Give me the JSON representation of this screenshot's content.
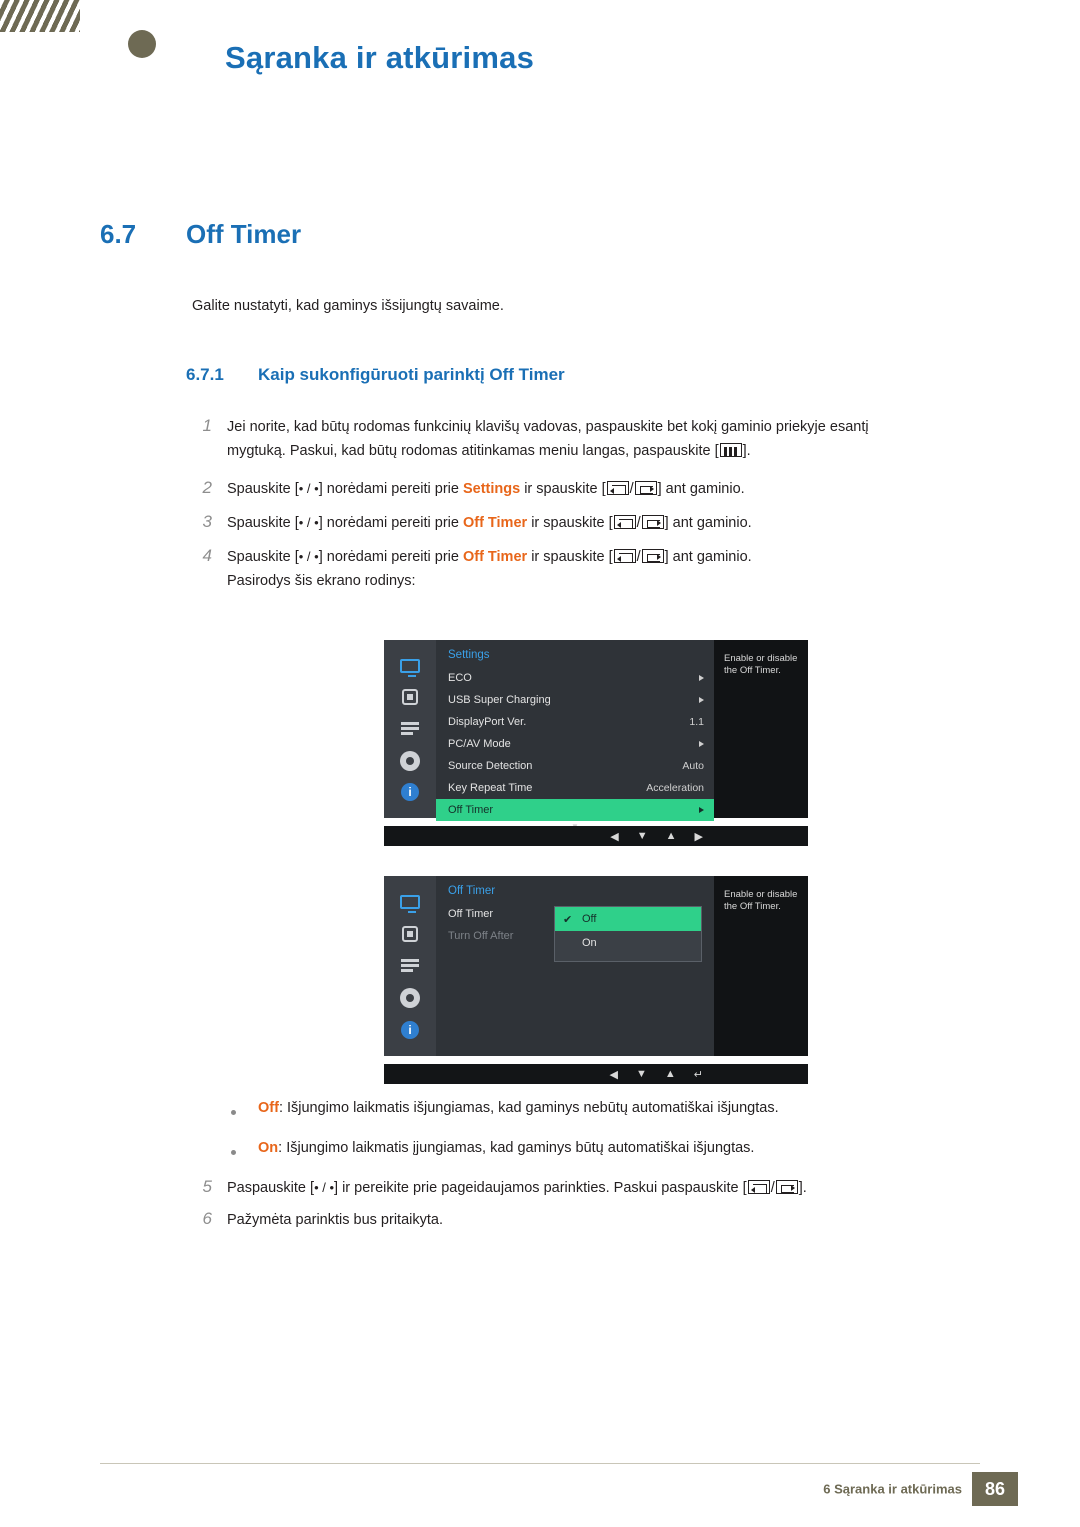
{
  "header": {
    "title": "Sąranka ir atkūrimas"
  },
  "section": {
    "number": "6.7",
    "title": "Off Timer",
    "intro": "Galite nustatyti, kad gaminys išsijungtų savaime.",
    "sub_number": "6.7.1",
    "sub_title": "Kaip sukonfigūruoti parinktį Off Timer"
  },
  "steps": [
    {
      "num": "1",
      "line1": "Jei norite, kad būtų rodomas funkcinių klavišų vadovas, paspauskite bet kokį gaminio priekyje esantį",
      "line2_a": "mygtuką. Paskui, kad būtų rodomas atitinkamas meniu langas, paspauskite [",
      "line2_b": "]."
    },
    {
      "num": "2",
      "a": "Spauskite [",
      "dots": "• / •",
      "b": "] norėdami pereiti prie ",
      "hl": "Settings",
      "c": " ir spauskite [",
      "d": "] ant gaminio."
    },
    {
      "num": "3",
      "a": "Spauskite [",
      "dots": "• / •",
      "b": "] norėdami pereiti prie ",
      "hl": "Off Timer",
      "c": " ir spauskite [",
      "d": "] ant gaminio."
    },
    {
      "num": "4",
      "a": "Spauskite [",
      "dots": "• / •",
      "b": "] norėdami pereiti prie ",
      "hl": "Off Timer",
      "c": " ir spauskite [",
      "d": "] ant gaminio.",
      "sub": "Pasirodys šis ekrano rodinys:"
    },
    {
      "num": "5",
      "a": "Paspauskite [",
      "dots": "• / •",
      "b": "] ir pereikite prie pageidaujamos parinkties. Paskui paspauskite [",
      "d": "]."
    },
    {
      "num": "6",
      "a": "Pažymėta parinktis bus pritaikyta."
    }
  ],
  "osd1": {
    "title": "Settings",
    "help": "Enable or disable\nthe Off Timer.",
    "rows": [
      {
        "label": "ECO",
        "value": "",
        "arrow": true
      },
      {
        "label": "USB Super Charging",
        "value": "",
        "arrow": true
      },
      {
        "label": "DisplayPort Ver.",
        "value": "1.1",
        "arrow": false
      },
      {
        "label": "PC/AV Mode",
        "value": "",
        "arrow": true
      },
      {
        "label": "Source Detection",
        "value": "Auto",
        "arrow": false
      },
      {
        "label": "Key Repeat Time",
        "value": "Acceleration",
        "arrow": false
      },
      {
        "label": "Off Timer",
        "value": "",
        "arrow": true,
        "selected": true
      }
    ],
    "nav": [
      "◀",
      "▼",
      "▲",
      "▶"
    ]
  },
  "osd2": {
    "title": "Off Timer",
    "help": "Enable or disable\nthe Off Timer.",
    "rows": [
      {
        "label": "Off Timer",
        "dim": false
      },
      {
        "label": "Turn Off After",
        "dim": true
      }
    ],
    "popup": [
      {
        "label": "Off",
        "selected": true
      },
      {
        "label": "On",
        "selected": false
      }
    ],
    "nav": [
      "◀",
      "▼",
      "▲",
      "↵"
    ]
  },
  "bullets": [
    {
      "term": "Off",
      "text": ": Išjungimo laikmatis išjungiamas, kad gaminys nebūtų automatiškai išjungtas."
    },
    {
      "term": "On",
      "text": ": Išjungimo laikmatis įjungiamas, kad gaminys būtų automatiškai išjungtas."
    }
  ],
  "footer": {
    "text": "6 Sąranka ir atkūrimas",
    "page": "86"
  },
  "colors": {
    "accent_blue": "#1a6fb5",
    "orange": "#e8661a",
    "olive": "#6e6a54",
    "osd_green": "#2fd08a"
  }
}
